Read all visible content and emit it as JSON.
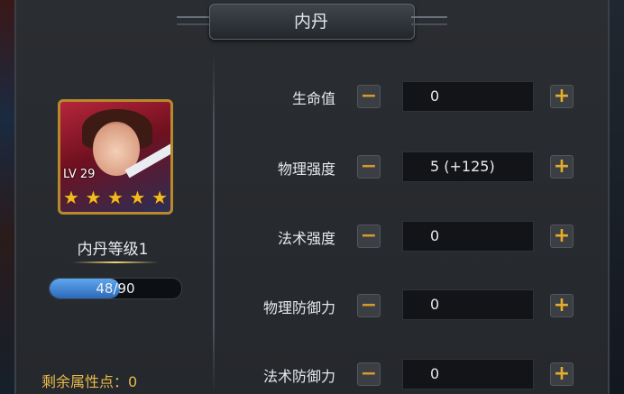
{
  "title": "内丹",
  "hero": {
    "level_text": "LV 29",
    "stars": [
      "★",
      "★",
      "★",
      "★",
      "★"
    ],
    "neidan_level_label": "内丹等级1",
    "exp_text": "48/90",
    "exp_progress": 0.533
  },
  "remaining_points_label": "剩余属性点：0",
  "attributes": [
    {
      "label": "生命值",
      "value": "0"
    },
    {
      "label": "物理强度",
      "value": "5 (+125)"
    },
    {
      "label": "法术强度",
      "value": "0"
    },
    {
      "label": "物理防御力",
      "value": "0"
    },
    {
      "label": "法术防御力",
      "value": "0"
    }
  ],
  "icons": {
    "minus": "minus-icon",
    "plus": "plus-icon"
  },
  "colors": {
    "accent_gold": "#e6ac2c",
    "exp_blue": "#2c69b8"
  }
}
